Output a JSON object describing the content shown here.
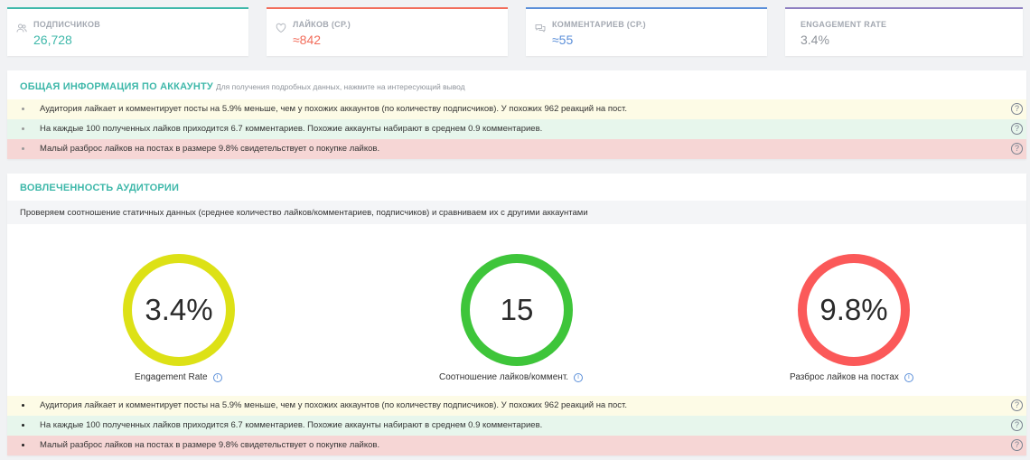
{
  "stats": [
    {
      "label": "Подписчиков",
      "value": "26,728",
      "icon": "people-icon",
      "color": "#3fb8aa"
    },
    {
      "label": "Лайков (ср.)",
      "value": "≈842",
      "icon": "heart-icon",
      "color": "#f26d5b"
    },
    {
      "label": "Комментариев (ср.)",
      "value": "≈55",
      "icon": "comments-icon",
      "color": "#5b8fd9"
    },
    {
      "label": "Engagement Rate",
      "value": "3.4%",
      "icon": "",
      "color": "#8e7fc1"
    }
  ],
  "overview": {
    "title": "ОБЩАЯ ИНФОРМАЦИЯ ПО АККАУНТУ",
    "subtitle": "Для получения подробных данных, нажмите на интересующий вывод",
    "rows": [
      {
        "text": "Аудитория лайкает и комментирует посты на 5.9% меньше, чем у похожих аккаунтов (по количеству подписчиков). У похожих 962 реакций на пост.",
        "tone": "yellow"
      },
      {
        "text": "На каждые 100 полученных лайков приходится 6.7 комментариев. Похожие аккаунты набирают в среднем 0.9 комментариев.",
        "tone": "green"
      },
      {
        "text": "Малый разброс лайков на постах в размере 9.8% свидетельствует о покупке лайков.",
        "tone": "red"
      }
    ],
    "help_glyph": "?"
  },
  "engagement": {
    "title": "ВОВЛЕЧЕННОСТЬ АУДИТОРИИ",
    "description": "Проверяем соотношение статичных данных (среднее количество лайков/комментариев, подписчиков) и сравниваем их с другими аккаунтами",
    "gauges": [
      {
        "value": "3.4%",
        "label": "Engagement Rate",
        "color": "#dde116"
      },
      {
        "value": "15",
        "label": "Соотношение лайков/коммент.",
        "color": "#3ec53a"
      },
      {
        "value": "9.8%",
        "label": "Разброс лайков на постах",
        "color": "#fb5959"
      }
    ],
    "info_glyph": "i",
    "rows": [
      {
        "text": "Аудитория лайкает и комментирует посты на 5.9% меньше, чем у похожих аккаунтов (по количеству подписчиков). У похожих 962 реакций на пост.",
        "tone": "yellow"
      },
      {
        "text": "На каждые 100 полученных лайков приходится 6.7 комментариев. Похожие аккаунты набирают в среднем 0.9 комментариев.",
        "tone": "green"
      },
      {
        "text": "Малый разброс лайков на постах в размере 9.8% свидетельствует о покупке лайков.",
        "tone": "red"
      }
    ]
  }
}
